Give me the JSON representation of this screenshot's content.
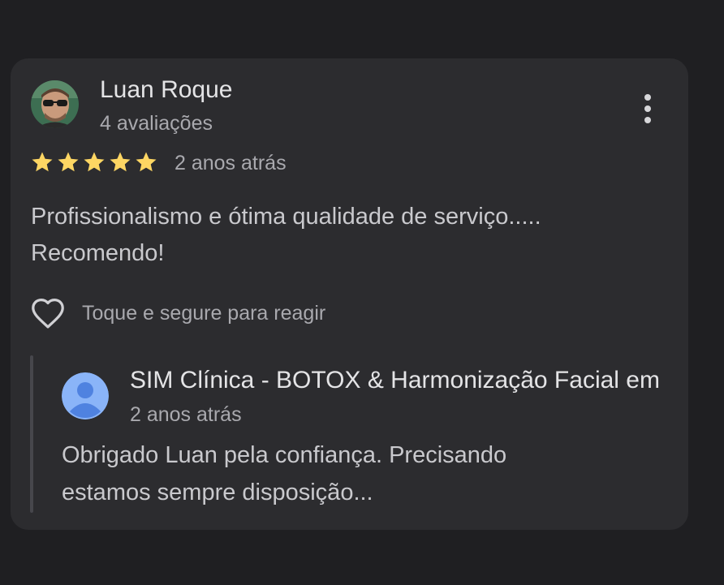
{
  "review": {
    "author_name": "Luan Roque",
    "author_meta": "4 avaliações",
    "rating": 5,
    "rating_max": 5,
    "time": "2 anos atrás",
    "text_lines": [
      "Profissionalismo e ótima qualidade de serviço.....",
      "Recomendo!"
    ],
    "react_label": "Toque e segure para reagir"
  },
  "owner_reply": {
    "name": "SIM Clínica - BOTOX & Harmonização Facial em",
    "time": "2 anos atrás",
    "text_lines": [
      "Obrigado Luan pela confiança. Precisando",
      "estamos sempre disposição..."
    ]
  },
  "colors": {
    "background": "#1f1f22",
    "card": "#2c2c2f",
    "star": "#fdd663",
    "owner_avatar": "#8ab4f8"
  },
  "icons": {
    "more": "more-vertical-icon",
    "star": "star-icon",
    "heart": "heart-outline-icon",
    "person": "person-icon"
  }
}
